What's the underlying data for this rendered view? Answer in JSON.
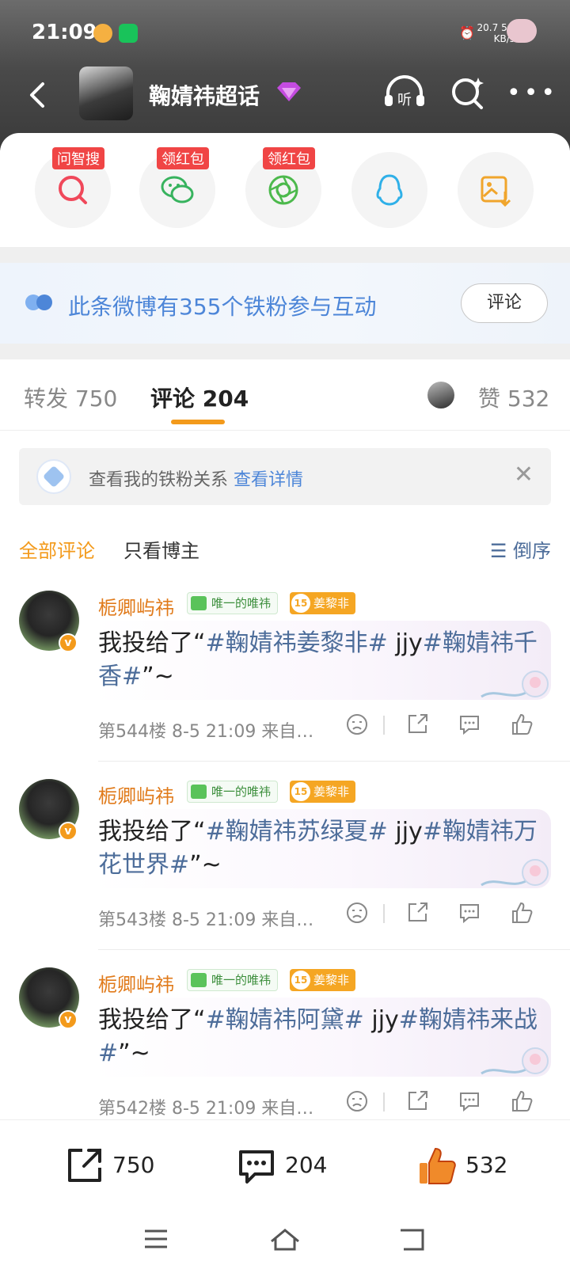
{
  "status": {
    "time": "21:09",
    "net_speed": "20.7",
    "net_unit": "KB/s",
    "signal": "5G"
  },
  "header": {
    "title": "鞠婧祎超话"
  },
  "share": [
    {
      "name": "zhisou",
      "tag": "问智搜"
    },
    {
      "name": "wechat",
      "tag": "领红包"
    },
    {
      "name": "moments",
      "tag": "领红包"
    },
    {
      "name": "qq",
      "tag": ""
    },
    {
      "name": "save-image",
      "tag": ""
    }
  ],
  "fan_banner": {
    "text": "此条微博有355个铁粉参与互动",
    "button": "评论"
  },
  "tabs": {
    "repost": "转发 750",
    "comment": "评论 204",
    "like": "赞 532"
  },
  "notice": {
    "text": "查看我的铁粉关系",
    "link": "查看详情"
  },
  "filter": {
    "all": "全部评论",
    "author_only": "只看博主",
    "order": "倒序"
  },
  "comments": [
    {
      "user": "栀卿屿祎",
      "badge_fan": "唯一的唯祎",
      "badge_level": "姜黎非",
      "text_pre": "我投给了“",
      "text_hash1": "#鞠婧祎姜黎非#",
      "text_mid": " jjy",
      "text_hash2": "#鞠婧祎千香#",
      "text_post": "”~",
      "meta": "第544楼 8-5 21:09 来自…"
    },
    {
      "user": "栀卿屿祎",
      "badge_fan": "唯一的唯祎",
      "badge_level": "姜黎非",
      "text_pre": "我投给了“",
      "text_hash1": "#鞠婧祎苏绿夏#",
      "text_mid": " jjy",
      "text_hash2": "#鞠婧祎万花世界#",
      "text_post": "”~",
      "meta": "第543楼 8-5 21:09 来自…"
    },
    {
      "user": "栀卿屿祎",
      "badge_fan": "唯一的唯祎",
      "badge_level": "姜黎非",
      "text_pre": "我投给了“",
      "text_hash1": "#鞠婧祎阿黛#",
      "text_mid": " jjy",
      "text_hash2": "#鞠婧祎来战#",
      "text_post": "”~",
      "meta": "第542楼 8-5 21:09 来自…"
    }
  ],
  "bottom_bar": {
    "repost": "750",
    "comment": "204",
    "like": "532"
  },
  "colors": {
    "accent": "#f39a1b",
    "link": "#4d86d8",
    "like": "#f08a2a"
  }
}
